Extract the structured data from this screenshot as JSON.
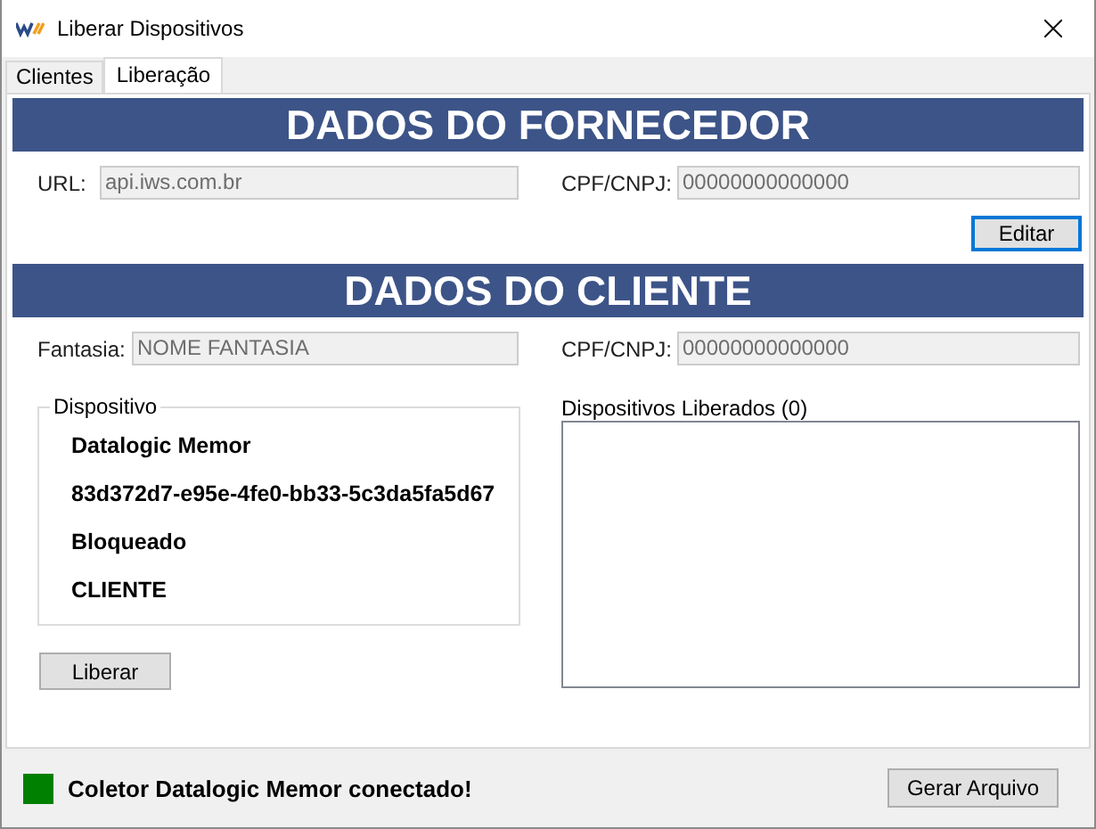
{
  "window": {
    "title": "Liberar Dispositivos"
  },
  "tabs": [
    {
      "label": "Clientes",
      "selected": false
    },
    {
      "label": "Liberação",
      "selected": true
    }
  ],
  "supplier": {
    "heading": "DADOS DO FORNECEDOR",
    "fields": [
      {
        "label": "URL:",
        "value": "api.iws.com.br"
      },
      {
        "label": "CPF/CNPJ:",
        "value": "00000000000000"
      }
    ],
    "button": {
      "label": "Editar",
      "focused": true
    }
  },
  "client": {
    "heading": "DADOS DO CLIENTE",
    "fields": [
      {
        "label": "Fantasia:",
        "value": "NOME FANTASIA"
      },
      {
        "label": "CPF/CNPJ:",
        "value": "00000000000000"
      }
    ],
    "device_group": {
      "legend": "Dispositivo",
      "lines": [
        "Datalogic Memor",
        "83d372d7-e95e-4fe0-bb33-5c3da5fa5d67",
        "Bloqueado",
        "CLIENTE"
      ]
    },
    "released_list": {
      "label": "Dispositivos Liberados (0)"
    },
    "button": {
      "label": "Liberar",
      "focused": false
    }
  },
  "status_bar": {
    "indicator": {
      "color": "#008000"
    },
    "message": "Coletor Datalogic Memor conectado!",
    "button": {
      "label": "Gerar Arquivo",
      "focused": false
    }
  }
}
